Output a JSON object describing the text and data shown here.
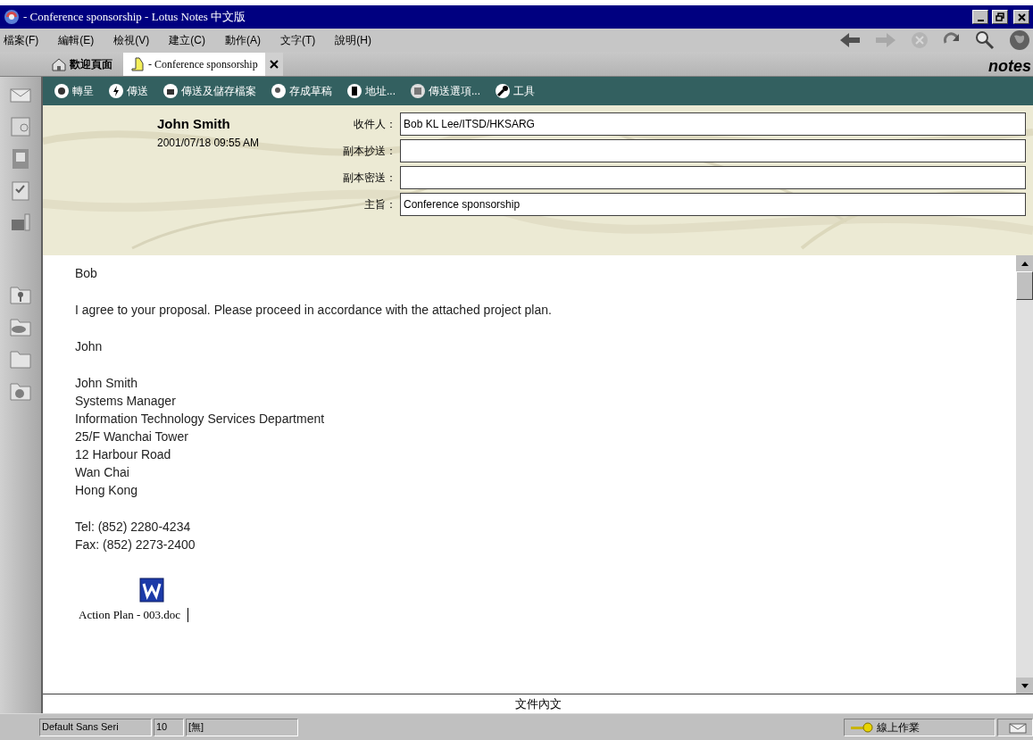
{
  "window": {
    "title": "- Conference sponsorship - Lotus Notes 中文版"
  },
  "menu": [
    "檔案(F)",
    "編輯(E)",
    "檢視(V)",
    "建立(C)",
    "動作(A)",
    "文字(T)",
    "說明(H)"
  ],
  "tabs": [
    {
      "label": "歡迎頁面",
      "selected": false,
      "closable": false
    },
    {
      "label": "- Conference sponsorship",
      "selected": true,
      "closable": true
    }
  ],
  "brand": "notes",
  "toolbar": [
    "轉呈",
    "傳送",
    "傳送及儲存檔案",
    "存成草稿",
    "地址...",
    "傳送選項...",
    "工具"
  ],
  "header": {
    "sender": "John Smith",
    "date": "2001/07/18 09:55 AM",
    "fields": [
      {
        "label": "收件人：",
        "value": "Bob KL Lee/ITSD/HKSARG"
      },
      {
        "label": "副本抄送："
      },
      {
        "label": "副本密送："
      },
      {
        "label": "主旨：",
        "value": "Conference sponsorship"
      }
    ]
  },
  "body": [
    [
      "Bob"
    ],
    [
      "I agree to your proposal. Please proceed in accordance with the attached project plan."
    ],
    [
      "John"
    ],
    [
      "John Smith",
      "Systems Manager",
      "Information Technology Services Department",
      "25/F Wanchai Tower",
      "12 Harbour Road",
      "Wan Chai",
      "Hong Kong"
    ],
    [
      "Tel:  (852) 2280-4234",
      "Fax: (852) 2273-2400"
    ]
  ],
  "attachment": {
    "name": "Action Plan - 003.doc"
  },
  "footer": "文件內文",
  "status_bar": {
    "font": "Default Sans Seri",
    "size": "10",
    "style": "[無]",
    "location": "線上作業"
  }
}
